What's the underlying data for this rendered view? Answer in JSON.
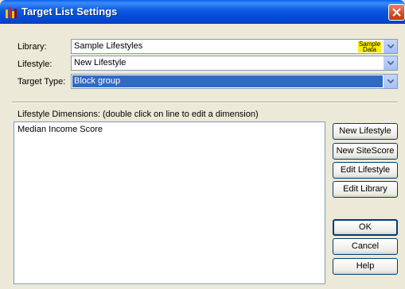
{
  "window": {
    "title": "Target List Settings"
  },
  "fields": {
    "library": {
      "label": "Library:",
      "value": "Sample Lifestyles",
      "badge": "Sample Data"
    },
    "lifestyle": {
      "label": "Lifestyle:",
      "value": "New Lifestyle"
    },
    "target_type": {
      "label": "Target Type:",
      "value": "Block group"
    }
  },
  "dimensions": {
    "label": "Lifestyle Dimensions: (double click on line to edit a dimension)",
    "items": [
      "Median Income Score"
    ]
  },
  "buttons": {
    "new_lifestyle": "New Lifestyle",
    "new_sitescore": "New SiteScore",
    "edit_lifestyle": "Edit Lifestyle",
    "edit_library": "Edit Library",
    "ok": "OK",
    "cancel": "Cancel",
    "help": "Help"
  },
  "colors": {
    "titlebar": "#0047d0",
    "selection": "#316ac5",
    "badge": "#ffee00",
    "dialog_bg": "#ece9d8"
  }
}
